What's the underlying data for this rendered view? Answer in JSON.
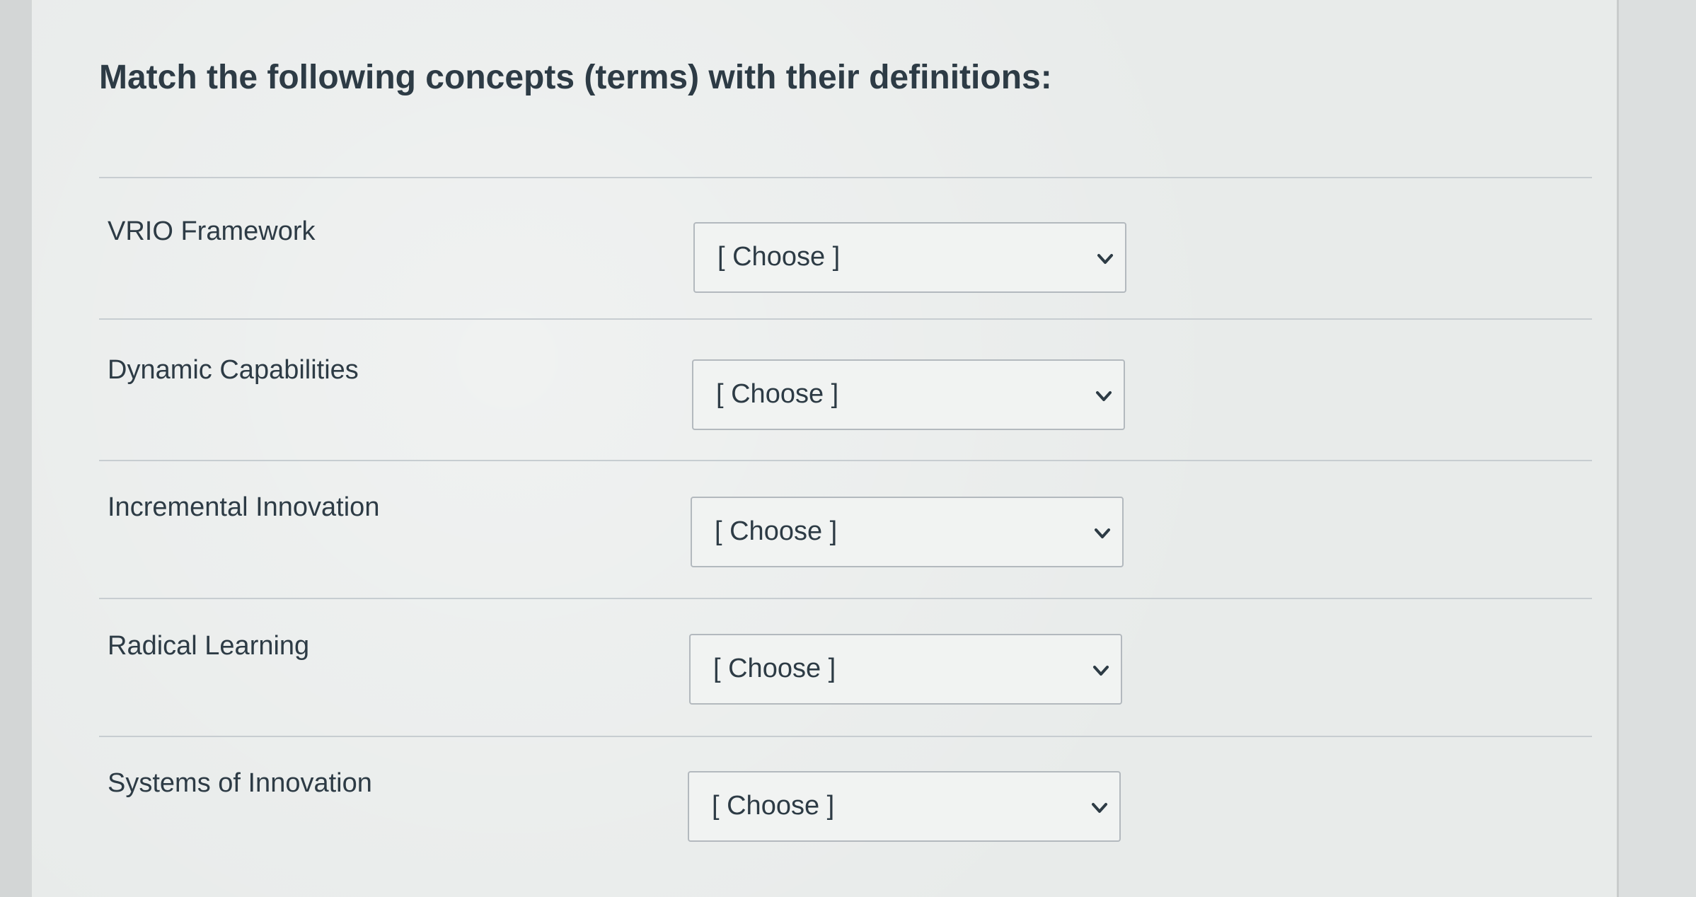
{
  "question": {
    "title": "Match the following concepts (terms) with their definitions:"
  },
  "rows": [
    {
      "term": "VRIO Framework",
      "selected": "[ Choose ]"
    },
    {
      "term": "Dynamic Capabilities",
      "selected": "[ Choose ]"
    },
    {
      "term": "Incremental Innovation",
      "selected": "[ Choose ]"
    },
    {
      "term": "Radical Learning",
      "selected": "[ Choose ]"
    },
    {
      "term": "Systems of Innovation",
      "selected": "[ Choose ]"
    }
  ],
  "icons": {
    "dropdown": "chevron-down-icon"
  }
}
